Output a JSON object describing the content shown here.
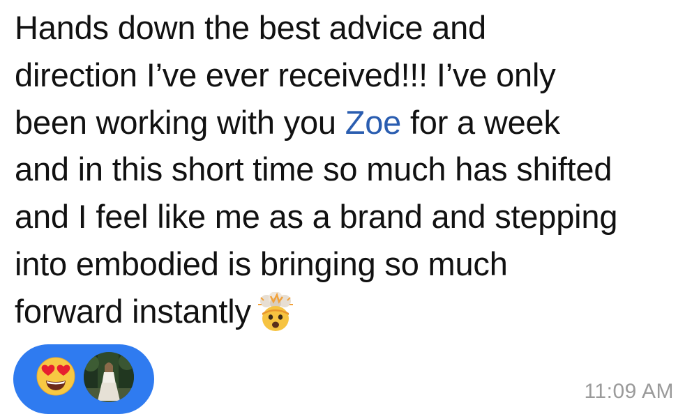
{
  "message": {
    "line1": "Hands down the best advice and",
    "line2": "direction I’ve ever received!!! I’ve only",
    "line3_before": "been working with you ",
    "line3_mention": "Zoe",
    "line3_after": " for a week",
    "line4": "and in this short time so much has shifted",
    "line5": "and I feel like me as a brand and stepping",
    "line6": "into embodied is bringing so much",
    "line7": "forward instantly",
    "trailing_emoji": "exploding-head-emoji"
  },
  "reaction": {
    "emoji": "heart-eyes-emoji",
    "avatar": "reactor-avatar",
    "pill_color": "#2f7bf0"
  },
  "timestamp": "11:09 AM",
  "colors": {
    "text": "#111111",
    "mention": "#2a5db0",
    "timestamp": "#9a9a9a"
  }
}
